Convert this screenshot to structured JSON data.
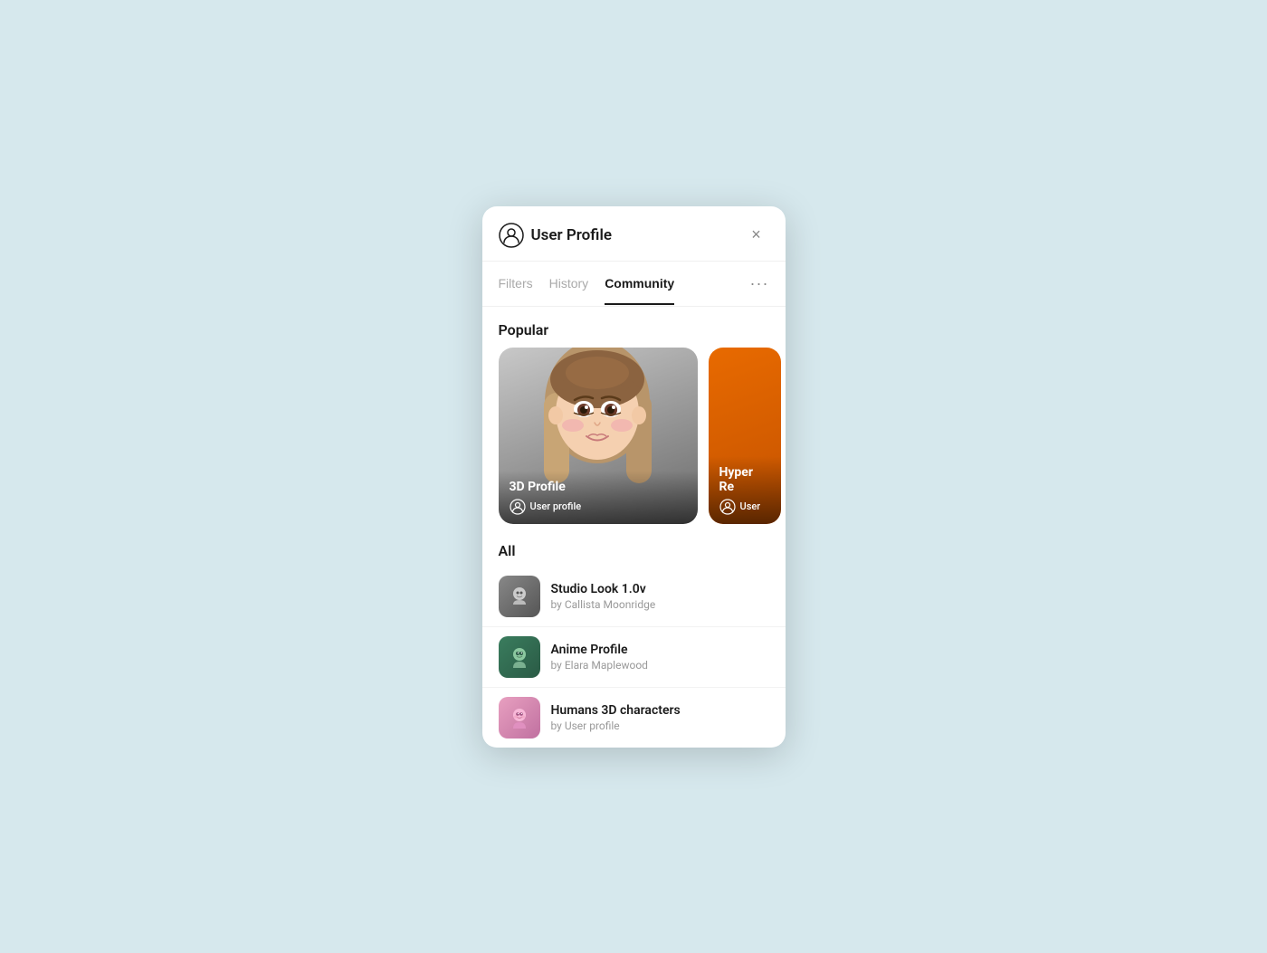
{
  "background_color": "#d6e8ed",
  "modal": {
    "title": "User Profile",
    "close_label": "×",
    "tabs": [
      {
        "id": "filters",
        "label": "Filters",
        "active": false
      },
      {
        "id": "history",
        "label": "History",
        "active": false
      },
      {
        "id": "community",
        "label": "Community",
        "active": true
      }
    ],
    "more_label": "···",
    "sections": {
      "popular": {
        "label": "Popular",
        "cards": [
          {
            "id": "3d-profile",
            "title": "3D Profile",
            "tag": "User profile",
            "type": "anime"
          },
          {
            "id": "hyper-re",
            "title": "Hyper Re",
            "tag": "User",
            "type": "orange"
          }
        ]
      },
      "all": {
        "label": "All",
        "items": [
          {
            "id": "studio-look",
            "name": "Studio Look 1.0v",
            "author": "by Callista Moonridge",
            "thumb_type": "studio"
          },
          {
            "id": "anime-profile",
            "name": "Anime Profile",
            "author": "by Elara Maplewood",
            "thumb_type": "anime"
          },
          {
            "id": "humans-3d",
            "name": "Humans 3D characters",
            "author": "by User profile",
            "thumb_type": "humans"
          }
        ]
      }
    }
  }
}
